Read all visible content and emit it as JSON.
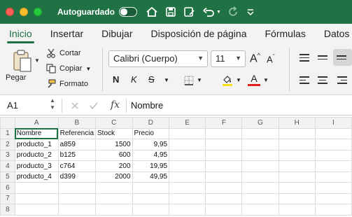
{
  "titlebar": {
    "autosave_label": "Autoguardado",
    "autosave_state": "off"
  },
  "tabs": [
    "Inicio",
    "Insertar",
    "Dibujar",
    "Disposición de página",
    "Fórmulas",
    "Datos"
  ],
  "ribbon": {
    "paste_label": "Pegar",
    "cut_label": "Cortar",
    "copy_label": "Copiar",
    "format_label": "Formato",
    "font_name": "Calibri (Cuerpo)",
    "font_size": "11",
    "bold": "N",
    "italic": "K",
    "strike": "S",
    "grow": "A",
    "shrink": "A",
    "font_color": "A"
  },
  "formula_bar": {
    "name_box": "A1",
    "fx": "fx",
    "content": "Nombre"
  },
  "sheet": {
    "columns": [
      "A",
      "B",
      "C",
      "D",
      "E",
      "F",
      "G",
      "H",
      "I"
    ],
    "rows": [
      [
        "1",
        "Nombre",
        "Referencia",
        "Stock",
        "Precio",
        "",
        "",
        "",
        "",
        ""
      ],
      [
        "2",
        "producto_1",
        "a859",
        "1500",
        "9,95",
        "",
        "",
        "",
        "",
        ""
      ],
      [
        "3",
        "producto_2",
        "b125",
        "600",
        "4,95",
        "",
        "",
        "",
        "",
        ""
      ],
      [
        "4",
        "producto_3",
        "c764",
        "200",
        "19,95",
        "",
        "",
        "",
        "",
        ""
      ],
      [
        "5",
        "producto_4",
        "d399",
        "2000",
        "49,95",
        "",
        "",
        "",
        "",
        ""
      ],
      [
        "6",
        "",
        "",
        "",
        "",
        "",
        "",
        "",
        "",
        ""
      ],
      [
        "7",
        "",
        "",
        "",
        "",
        "",
        "",
        "",
        "",
        ""
      ],
      [
        "8",
        "",
        "",
        "",
        "",
        "",
        "",
        "",
        "",
        ""
      ]
    ]
  },
  "colors": {
    "brand": "#207245",
    "accent": "#1e7145"
  }
}
